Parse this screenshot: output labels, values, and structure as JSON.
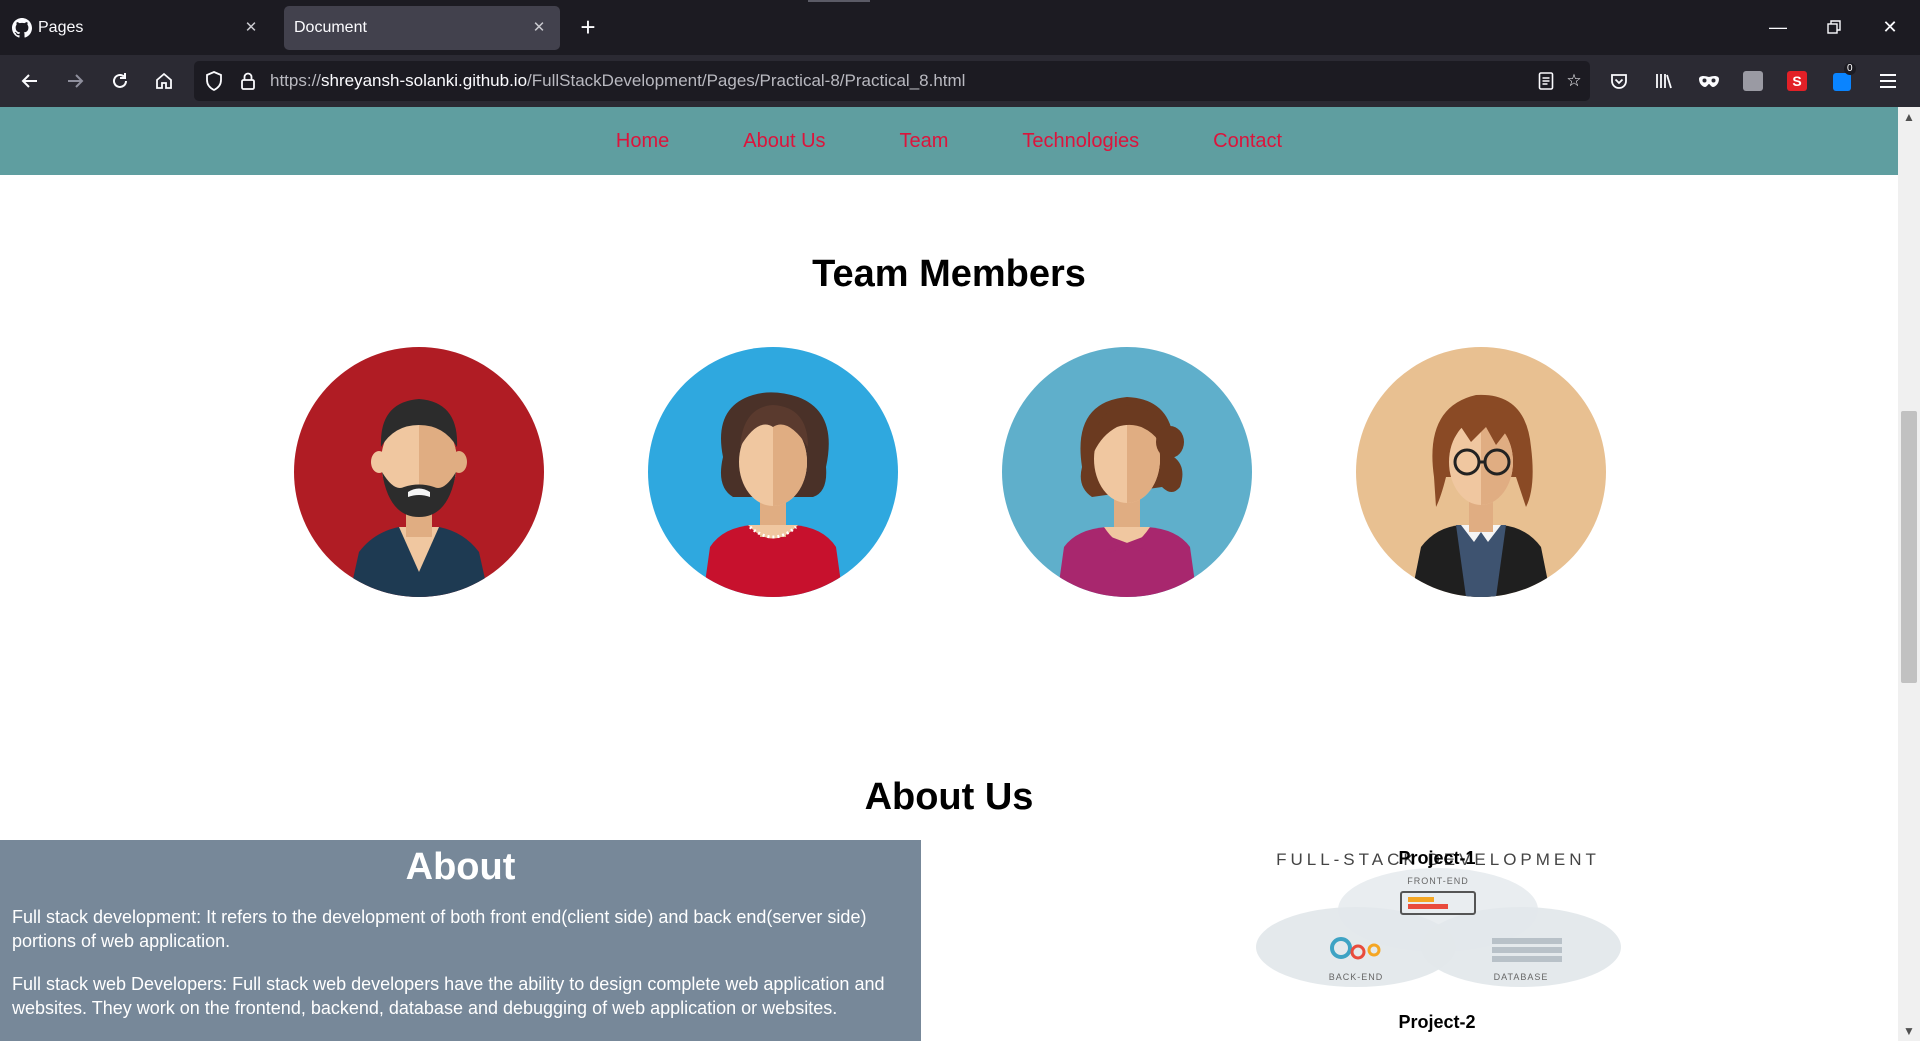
{
  "browser": {
    "tabs": [
      {
        "label": "Pages",
        "active": false,
        "icon": "github-icon"
      },
      {
        "label": "Document",
        "active": true
      }
    ],
    "url_scheme": "https://",
    "url_host": "shreyansh-solanki.github.io",
    "url_path": "/FullStackDevelopment/Pages/Practical-8/Practical_8.html",
    "counter_badge": "0"
  },
  "site": {
    "nav": [
      "Home",
      "About Us",
      "Team",
      "Technologies",
      "Contact"
    ],
    "team_heading": "Team Members",
    "about_heading": "About Us",
    "about": {
      "title": "About",
      "paragraphs": [
        "Full stack development: It refers to the development of both front end(client side) and back end(server side) portions of web application.",
        "Full stack web Developers: Full stack web developers have the ability to design complete web application and websites. They work on the frontend, backend, database and debugging of web application or websites."
      ]
    },
    "projects": {
      "project1": "Project-1",
      "project2": "Project-2",
      "diagram_title": "FULL-STACK DEVELOPMENT",
      "front_end": "FRONT-END",
      "back_end": "BACK-END",
      "database": "DATABASE"
    },
    "avatars": [
      {
        "name": "man-beard-avatar",
        "bg": "#b01c24"
      },
      {
        "name": "woman-curly-avatar",
        "bg": "#2fa8df"
      },
      {
        "name": "woman-ponytail-avatar",
        "bg": "#5fafcb"
      },
      {
        "name": "woman-glasses-avatar",
        "bg": "#e8c091"
      }
    ]
  },
  "colors": {
    "nav_bg": "#5f9ea0",
    "nav_link": "#dc143c",
    "about_bg": "#778899"
  }
}
